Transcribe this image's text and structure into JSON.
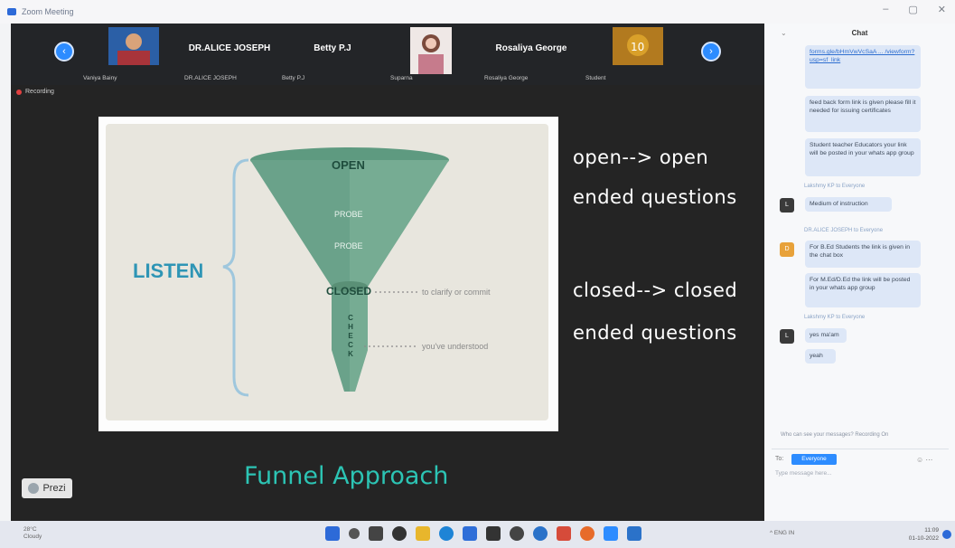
{
  "window": {
    "title": "Zoom Meeting",
    "controls": [
      "–",
      "▢",
      "✕"
    ]
  },
  "participants": [
    {
      "label": "Vaniya Bainy"
    },
    {
      "big": "DR.ALICE JOSEPH",
      "label": "DR.ALICE JOSEPH"
    },
    {
      "big": "Betty P.J",
      "label": "Betty P.J"
    },
    {
      "label": "Suparna"
    },
    {
      "big": "Rosaliya George",
      "label": "Rosaliya George"
    },
    {
      "label": "Student"
    }
  ],
  "recording_label": "Recording",
  "slide": {
    "funnel_stages": [
      "OPEN",
      "PROBE",
      "PROBE",
      "CLOSED",
      "C",
      "H",
      "E",
      "C",
      "K"
    ],
    "listen": "LISTEN",
    "annotation_clarify": "to clarify or commit",
    "annotation_understood": "you've understood"
  },
  "notes": {
    "open_line1": "open--> open",
    "open_line2": "ended questions",
    "closed_line1": "closed--> closed",
    "closed_line2": "ended questions"
  },
  "funnel_title": "Funnel Approach",
  "prezi_label": "Prezi",
  "chat": {
    "title": "Chat",
    "messages": [
      {
        "type": "link",
        "text": "forms.gle/bHmVwVcSaA ... /viewform?usp=sf_link"
      },
      {
        "type": "text",
        "text": "feed back form link is given please fill it needed for issuing certificates"
      },
      {
        "type": "text",
        "text": "Student teacher Educators your link will be posted in your whats app group"
      },
      {
        "sender": "Lakshmy KP to Everyone",
        "text": "Medium of instruction"
      },
      {
        "sender": "DR.ALICE JOSEPH to Everyone",
        "text": "For B.Ed Students the link is given in the chat box"
      },
      {
        "type": "text",
        "text": "For M.Ed/D.Ed the link will be posted in your whats app group"
      },
      {
        "sender": "Lakshmy KP to Everyone",
        "text": "yes ma'am"
      },
      {
        "type": "text",
        "text": "yeah"
      }
    ],
    "notice": "Who can see your messages? Recording On",
    "to_label": "To:",
    "recipient": "Everyone",
    "input_placeholder": "Type message here..."
  },
  "taskbar": {
    "weather_temp": "28°C",
    "weather_desc": "Cloudy",
    "tray": "ENG IN",
    "time": "11:09",
    "date": "01-10-2022"
  },
  "colors": {
    "zoom_blue": "#2d8cff",
    "funnel_green": "#6aa28a",
    "listen_blue": "#2e95b5",
    "funnel_title": "#2cc4b4"
  }
}
